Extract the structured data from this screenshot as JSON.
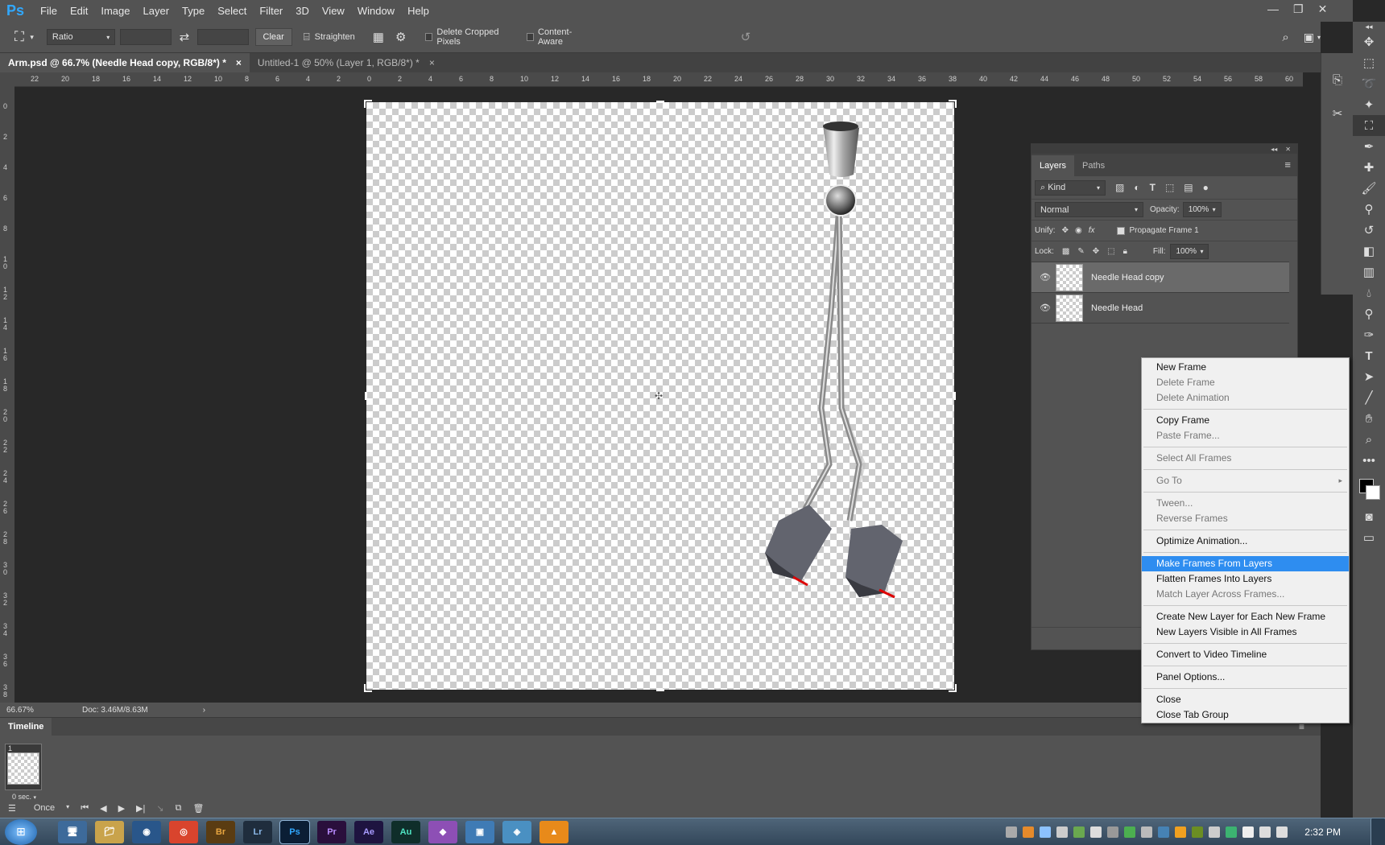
{
  "app": {
    "logo": "Ps"
  },
  "menu": [
    "File",
    "Edit",
    "Image",
    "Layer",
    "Type",
    "Select",
    "Filter",
    "3D",
    "View",
    "Window",
    "Help"
  ],
  "options": {
    "ratio": "Ratio",
    "clear": "Clear",
    "straighten": "Straighten",
    "delete_cropped": "Delete Cropped Pixels",
    "content_aware": "Content-Aware"
  },
  "tabs": [
    {
      "label": "Arm.psd @ 66.7% (Needle Head copy, RGB/8*) *",
      "close": "×"
    },
    {
      "label": "Untitled-1 @ 50% (Layer 1, RGB/8*) *",
      "close": "×"
    }
  ],
  "ruler": {
    "h": [
      "22",
      "20",
      "18",
      "16",
      "14",
      "12",
      "10",
      "8",
      "6",
      "4",
      "2",
      "0",
      "2",
      "4",
      "6",
      "8",
      "10",
      "12",
      "14",
      "16",
      "18",
      "20",
      "22",
      "24",
      "26",
      "28",
      "30",
      "32",
      "34",
      "36",
      "38",
      "40",
      "42",
      "44",
      "46",
      "48",
      "50",
      "52",
      "54",
      "56",
      "58",
      "60"
    ],
    "v": [
      "0",
      "2",
      "4",
      "6",
      "8",
      "1 0",
      "1 2",
      "1 4",
      "1 6",
      "1 8",
      "2 0",
      "2 2",
      "2 4",
      "2 6",
      "2 8",
      "3 0",
      "3 2",
      "3 4",
      "3 6",
      "3 8"
    ]
  },
  "status": {
    "zoom": "66.67%",
    "doc": "Doc: 3.46M/8.63M"
  },
  "timeline": {
    "title": "Timeline",
    "frame_number": "1",
    "frame_delay": "0 sec.",
    "loop": "Once"
  },
  "layers": {
    "tabs": [
      "Layers",
      "Paths"
    ],
    "filter": "Kind",
    "blend_mode": "Normal",
    "opacity_label": "Opacity:",
    "opacity": "100%",
    "unify_label": "Unify:",
    "propagate": "Propagate Frame 1",
    "lock_label": "Lock:",
    "fill_label": "Fill:",
    "fill": "100%",
    "items": [
      {
        "name": "Needle Head copy",
        "selected": true
      },
      {
        "name": "Needle Head",
        "selected": false
      }
    ]
  },
  "context_menu": {
    "groups": [
      [
        {
          "label": "New Frame",
          "enabled": true
        },
        {
          "label": "Delete Frame",
          "enabled": false
        },
        {
          "label": "Delete Animation",
          "enabled": false
        }
      ],
      [
        {
          "label": "Copy Frame",
          "enabled": true
        },
        {
          "label": "Paste Frame...",
          "enabled": false
        }
      ],
      [
        {
          "label": "Select All Frames",
          "enabled": false
        }
      ],
      [
        {
          "label": "Go To",
          "enabled": false,
          "submenu": true
        }
      ],
      [
        {
          "label": "Tween...",
          "enabled": false
        },
        {
          "label": "Reverse Frames",
          "enabled": false
        }
      ],
      [
        {
          "label": "Optimize Animation...",
          "enabled": true
        }
      ],
      [
        {
          "label": "Make Frames From Layers",
          "enabled": true,
          "highlighted": true
        },
        {
          "label": "Flatten Frames Into Layers",
          "enabled": true
        },
        {
          "label": "Match Layer Across Frames...",
          "enabled": false
        }
      ],
      [
        {
          "label": "Create New Layer for Each New Frame",
          "enabled": true
        },
        {
          "label": "New Layers Visible in All Frames",
          "enabled": true
        }
      ],
      [
        {
          "label": "Convert to Video Timeline",
          "enabled": true
        }
      ],
      [
        {
          "label": "Panel Options...",
          "enabled": true
        }
      ],
      [
        {
          "label": "Close",
          "enabled": true
        },
        {
          "label": "Close Tab Group",
          "enabled": true
        }
      ]
    ]
  },
  "taskbar": {
    "apps": [
      {
        "label": "Br",
        "color": "#5a3c12",
        "fg": "#e8a640"
      },
      {
        "label": "Lr",
        "color": "#1f2d3d",
        "fg": "#8bb8e8"
      },
      {
        "label": "Ps",
        "color": "#0b1e35",
        "fg": "#31a8ff"
      },
      {
        "label": "Pr",
        "color": "#2a0f3c",
        "fg": "#b98cff"
      },
      {
        "label": "Ae",
        "color": "#1e1440",
        "fg": "#a89cff"
      },
      {
        "label": "Au",
        "color": "#0f2e2a",
        "fg": "#4fe3c2"
      }
    ],
    "time": "2:32 PM"
  },
  "colors": {
    "accent": "#2e8df0",
    "panel": "#535353",
    "canvas_bg": "#282828"
  }
}
